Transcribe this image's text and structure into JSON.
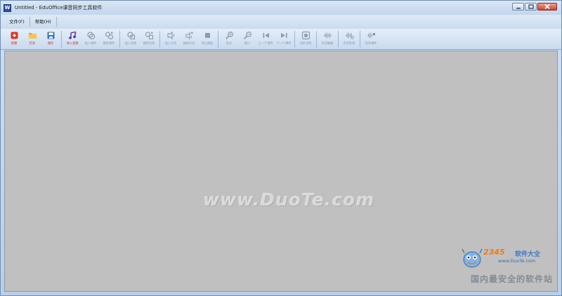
{
  "window": {
    "title": "Untitled - EduOffice课音同步工具软件",
    "app_icon_glyph": "W"
  },
  "menu": {
    "items": [
      {
        "label": "文件(F)"
      },
      {
        "label": "帮助(H)"
      }
    ]
  },
  "toolbar": {
    "groups": [
      [
        {
          "icon": "new-icon",
          "label": "新建",
          "enabled": true,
          "color": "#e0321f"
        },
        {
          "icon": "open-folder-icon",
          "label": "打开",
          "enabled": true,
          "color": "#f0a21a"
        },
        {
          "icon": "save-icon",
          "label": "保存",
          "enabled": true,
          "color": "#3a6fc0"
        }
      ],
      [
        {
          "icon": "import-audio-icon",
          "label": "导入音频",
          "enabled": true,
          "color": "#5a2fa3"
        },
        {
          "icon": "insert-icon",
          "label": "插入课件",
          "enabled": false
        },
        {
          "icon": "delete-icon",
          "label": "删除课件",
          "enabled": false
        }
      ],
      [
        {
          "icon": "insert2-icon",
          "label": "插入背景",
          "enabled": false
        },
        {
          "icon": "delete2-icon",
          "label": "删除背景",
          "enabled": false
        }
      ],
      [
        {
          "icon": "insert3-icon",
          "label": "插入声音",
          "enabled": false
        },
        {
          "icon": "delete3-icon",
          "label": "删除声音",
          "enabled": false
        },
        {
          "icon": "stop-icon",
          "label": "停止播放",
          "enabled": false
        }
      ],
      [
        {
          "icon": "zoom-in-icon",
          "label": "放大",
          "enabled": false
        },
        {
          "icon": "zoom-out-icon",
          "label": "缩小",
          "enabled": false
        },
        {
          "icon": "prev-icon",
          "label": "上一个课件",
          "enabled": false
        },
        {
          "icon": "next-icon",
          "label": "下一个课件",
          "enabled": false
        }
      ],
      [
        {
          "icon": "record-icon",
          "label": "同步录制",
          "enabled": false
        }
      ],
      [
        {
          "icon": "audio-wave-icon",
          "label": "声音编辑",
          "enabled": false
        }
      ],
      [
        {
          "icon": "audio-edit-icon",
          "label": "声音处理",
          "enabled": false
        }
      ],
      [
        {
          "icon": "audio-out-icon",
          "label": "发布课件",
          "enabled": false
        }
      ]
    ]
  },
  "watermark": {
    "text": "www.DuoTe.com",
    "logo_brand": "2345软件大全",
    "logo_num": "2345",
    "logo_rest": "软件大全",
    "logo_site": "www.DuoTe.com",
    "slogan": "国内最安全的软件站"
  }
}
